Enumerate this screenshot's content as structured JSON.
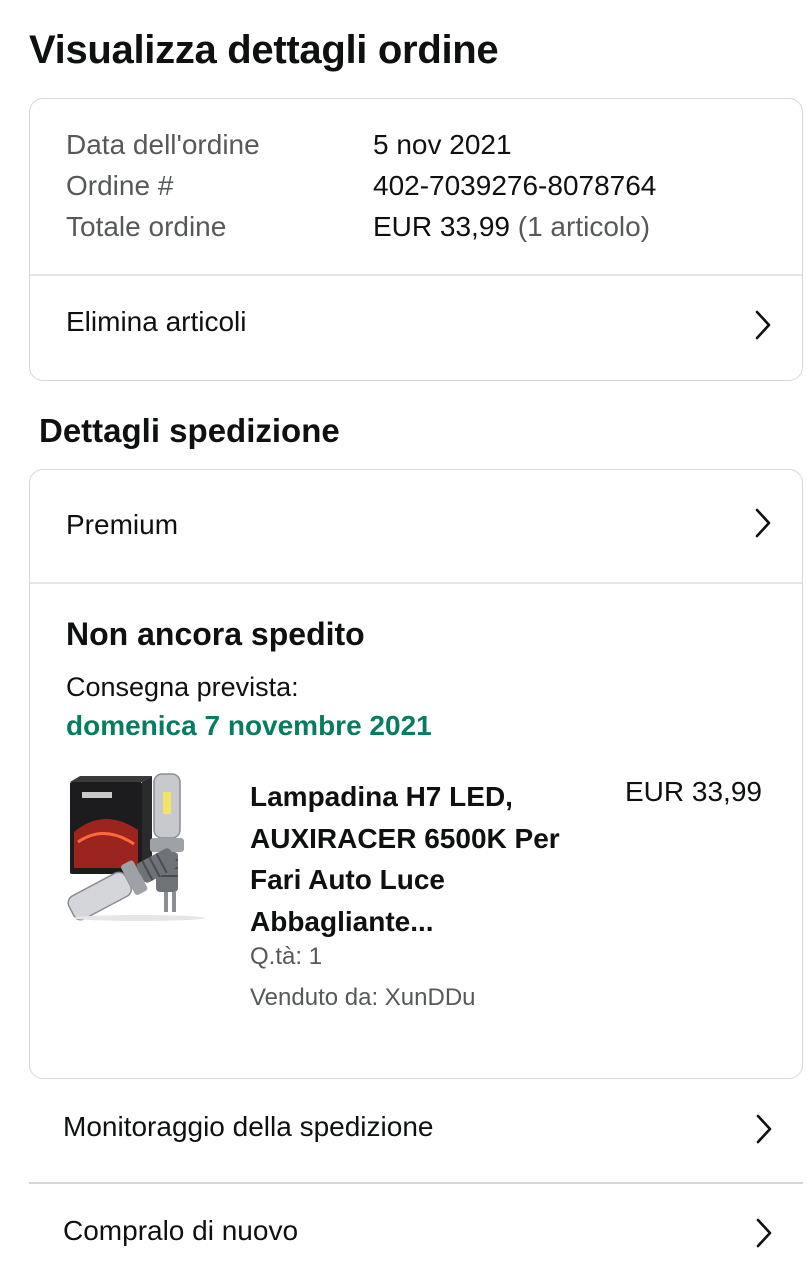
{
  "page": {
    "title": "Visualizza dettagli ordine"
  },
  "order_summary": {
    "date_label": "Data dell'ordine",
    "date_value": "5 nov 2021",
    "order_label": "Ordine #",
    "order_value": "402-7039276-8078764",
    "total_label": "Totale ordine",
    "total_value": "EUR 33,99",
    "total_items": "(1 articolo)",
    "delete_items_label": "Elimina articoli"
  },
  "shipment": {
    "section_title": "Dettagli spedizione",
    "shipping_option": "Premium",
    "status": "Non ancora spedito",
    "eta_label": "Consegna prevista:",
    "eta_date": "domenica 7 novembre 2021",
    "eta_color": "#067d62",
    "product": {
      "title": "Lampadina H7 LED, AUXIRACER 6500K Per Fari Auto Luce Abbagliante...",
      "price": "EUR 33,99",
      "quantity": "Q.tà: 1",
      "seller": "Venduto da: XunDDu"
    }
  },
  "actions": {
    "track_label": "Monitoraggio della spedizione",
    "buy_again_label": "Compralo di nuovo"
  },
  "icons": {
    "chevron": "chevron-right-icon"
  }
}
